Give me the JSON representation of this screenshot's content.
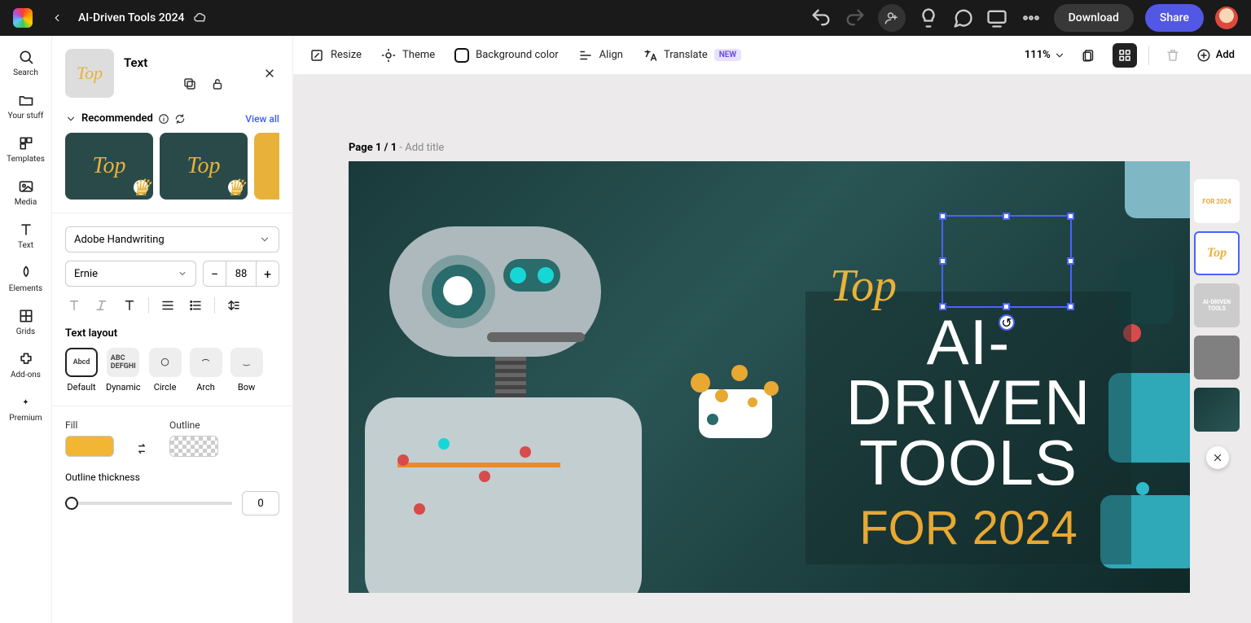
{
  "doc_title": "AI-Driven Tools 2024",
  "topbar": {
    "download": "Download",
    "share": "Share"
  },
  "rail": {
    "search": "Search",
    "your_stuff": "Your stuff",
    "templates": "Templates",
    "media": "Media",
    "text": "Text",
    "elements": "Elements",
    "grids": "Grids",
    "addons": "Add-ons",
    "premium": "Premium"
  },
  "panel": {
    "title": "Text",
    "recommended": "Recommended",
    "view_all": "View all",
    "font_family": "Adobe Handwriting",
    "font_style": "Ernie",
    "font_size": "88",
    "text_layout_title": "Text layout",
    "layouts": {
      "default": "Default",
      "dynamic": "Dynamic",
      "circle": "Circle",
      "arch": "Arch",
      "bow": "Bow"
    },
    "fill_label": "Fill",
    "outline_label": "Outline",
    "outline_thick_label": "Outline thickness",
    "outline_thick_value": "0",
    "fill_color": "#f1b633"
  },
  "canvas_toolbar": {
    "resize": "Resize",
    "theme": "Theme",
    "bgcolor": "Background color",
    "align": "Align",
    "translate": "Translate",
    "new_badge": "NEW",
    "zoom": "111%",
    "add": "Add"
  },
  "stage": {
    "page_label": "Page 1 / 1",
    "add_title_hint": "Add title",
    "artboard": {
      "script": "Top",
      "line1": "AI-DRIVEN",
      "line2": "TOOLS",
      "year": "FOR 2024"
    }
  },
  "thumbs": {
    "t1": "FOR 2024",
    "t2": "Top",
    "t3": "AI-DRIVEN TOOLS"
  }
}
